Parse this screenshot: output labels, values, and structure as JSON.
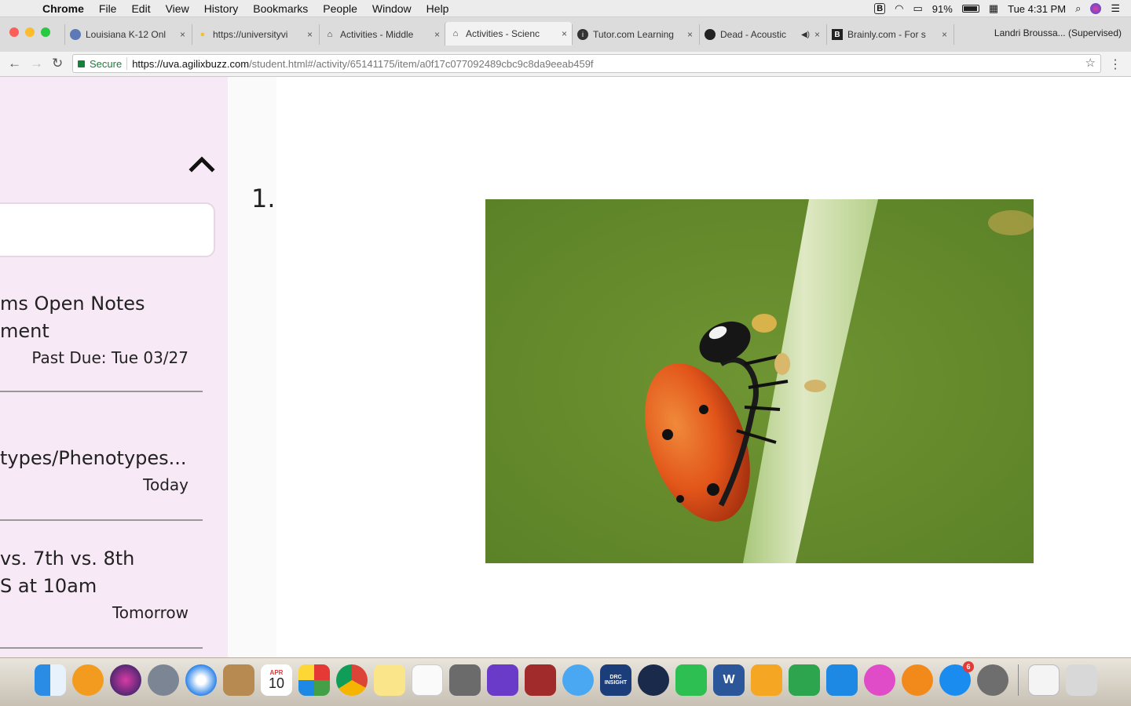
{
  "menubar": {
    "app": "Chrome",
    "items": [
      "File",
      "Edit",
      "View",
      "History",
      "Bookmarks",
      "People",
      "Window",
      "Help"
    ],
    "battery": "91%",
    "clock": "Tue 4:31 PM"
  },
  "tabs": [
    {
      "label": "Louisiana K-12 Onl",
      "icon": "globe-icon"
    },
    {
      "label": "https://universityvi",
      "icon": "bulb-icon"
    },
    {
      "label": "Activities - Middle",
      "icon": "buzz-icon"
    },
    {
      "label": "Activities - Scienc",
      "icon": "buzz-icon",
      "active": true
    },
    {
      "label": "Tutor.com Learning",
      "icon": "info-icon"
    },
    {
      "label": "Dead - Acoustic",
      "icon": "spotify-icon"
    },
    {
      "label": "Brainly.com - For s",
      "icon": "brainly-icon"
    }
  ],
  "profile": "Landri Broussa... (Supervised)",
  "omnibox": {
    "secure_label": "Secure",
    "url_host": "https://uva.agilixbuzz.com",
    "url_path": "/student.html#/activity/65141175/item/a0f17c077092489cbc9c8da9eeab459f"
  },
  "sidebar": {
    "items": [
      {
        "title": "ms Open Notes\nment",
        "due": "Past Due: Tue 03/27"
      },
      {
        "title": "types/Phenotypes...",
        "due": "Today"
      },
      {
        "title": "vs. 7th vs. 8th\nS at 10am",
        "due": "Tomorrow"
      }
    ]
  },
  "main": {
    "question_number": "1."
  },
  "dock": {
    "calendar_month": "APR",
    "calendar_day": "10",
    "drc_label": "DRC INSIGHT",
    "appstore_badge": "6"
  }
}
